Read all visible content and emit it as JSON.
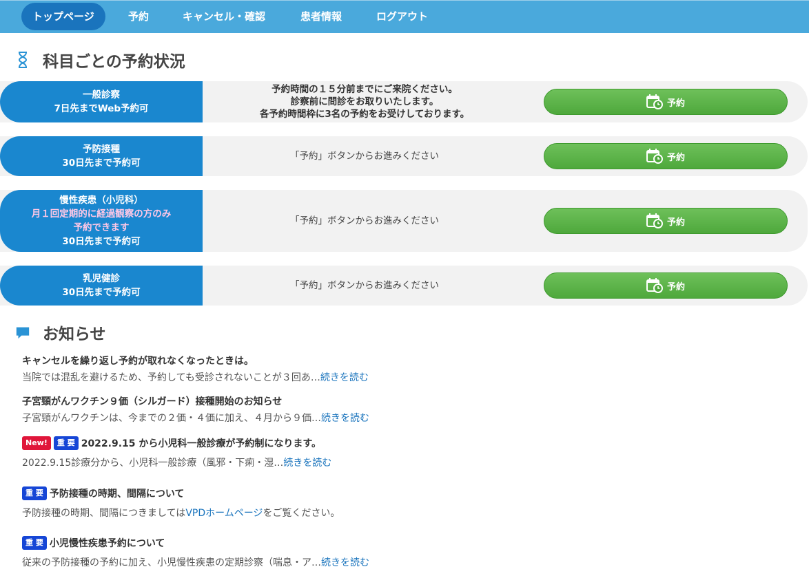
{
  "nav": {
    "items": [
      "トップページ",
      "予約",
      "キャンセル・確認",
      "患者情報",
      "ログアウト"
    ]
  },
  "reservations": {
    "heading": "科目ごとの予約状況",
    "rows": [
      {
        "label_lines": [
          "一般診察",
          "7日先までWeb予約可"
        ],
        "desc_lines": [
          "予約時間の１５分前までにご来院ください。",
          "診察前に問診をお取りいたします。",
          "各予約時間枠に3名の予約をお受けしております。"
        ],
        "button": "予約"
      },
      {
        "label_lines": [
          "予防接種",
          "30日先まで予約可"
        ],
        "desc_lines": [
          "「予約」ボタンからお進みください"
        ],
        "button": "予約"
      },
      {
        "label_lines": [
          "慢性疾患（小児科）"
        ],
        "label_pink_lines": [
          "月１回定期的に経過観察の方のみ",
          "予約できます"
        ],
        "label_tail_lines": [
          "30日先まで予約可"
        ],
        "desc_lines": [
          "「予約」ボタンからお進みください"
        ],
        "button": "予約"
      },
      {
        "label_lines": [
          "乳児健診",
          "30日先まで予約可"
        ],
        "desc_lines": [
          "「予約」ボタンからお進みください"
        ],
        "button": "予約"
      }
    ]
  },
  "news": {
    "heading": "お知らせ",
    "items": [
      {
        "title": "キャンセルを繰り返し予約が取れなくなったときは。",
        "excerpt": "当院では混乱を避けるため、予約しても受診されないことが３回あ…",
        "link": "続きを読む"
      },
      {
        "title": "子宮頸がんワクチン９価（シルガード）接種開始のお知らせ",
        "excerpt": "子宮頸がんワクチンは、今までの２価・４価に加え、４月から９価…",
        "link": "続きを読む"
      },
      {
        "badges": [
          "New!",
          "重 要"
        ],
        "title": "2022.9.15 から小児科一般診療が予約制になります。",
        "excerpt": "2022.9.15診療分から、小児科一般診療（風邪・下痢・湿…",
        "link": "続きを読む"
      },
      {
        "badges": [
          "重 要"
        ],
        "title": "予防接種の時期、間隔について",
        "excerpt_pre": "予防接種の時期、間隔につきましては",
        "link": "VPDホームページ",
        "excerpt_post": "をご覧ください。"
      },
      {
        "badges": [
          "重 要"
        ],
        "title": "小児慢性疾患予約について",
        "excerpt": "従来の予防接種の予約に加え、小児慢性疾患の定期診察（喘息・ア…",
        "link": "続きを読む"
      }
    ]
  },
  "colors": {
    "nav_bg": "#4aa9dc",
    "nav_active": "#1a74bd",
    "label_bg": "#1a87cf",
    "button_green": "#5cb247",
    "badge_new": "#e0163a",
    "badge_important": "#1646d6",
    "link": "#1a74bd"
  },
  "icons": {
    "reservation_heading": "hourglass-icon",
    "news_heading": "speech-bubble-icon",
    "button": "calendar-clock-icon"
  }
}
